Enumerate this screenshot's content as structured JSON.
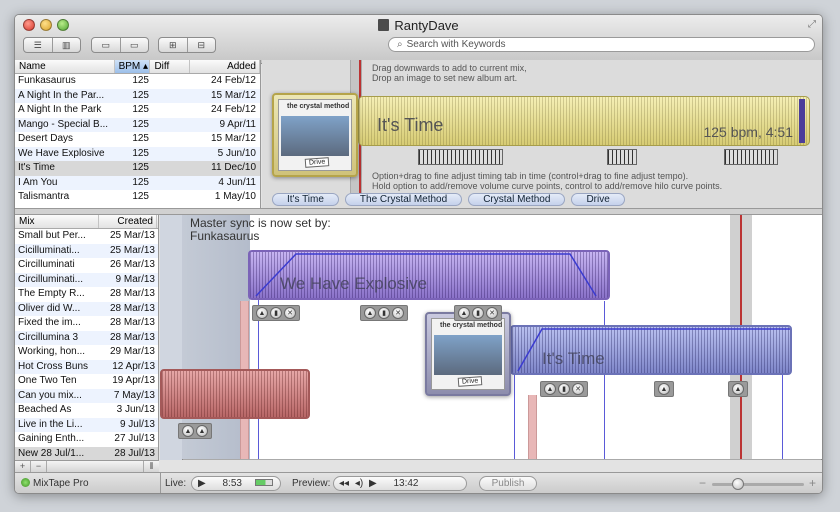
{
  "window": {
    "title": "RantyDave"
  },
  "search": {
    "placeholder": "Search with Keywords"
  },
  "songs": {
    "columns": [
      "Name",
      "BPM",
      "Diff",
      "Added"
    ],
    "rows": [
      {
        "name": "Funkasaurus",
        "bpm": "125",
        "diff": "",
        "added": "24 Feb/12"
      },
      {
        "name": "A Night In the Par...",
        "bpm": "125",
        "diff": "",
        "added": "15 Mar/12"
      },
      {
        "name": "A Night In the Park",
        "bpm": "125",
        "diff": "",
        "added": "24 Feb/12"
      },
      {
        "name": "Mango - Special B...",
        "bpm": "125",
        "diff": "",
        "added": "9 Apr/11"
      },
      {
        "name": "Desert Days",
        "bpm": "125",
        "diff": "",
        "added": "15 Mar/12"
      },
      {
        "name": "We Have Explosive",
        "bpm": "125",
        "diff": "",
        "added": "5 Jun/10"
      },
      {
        "name": "It's Time",
        "bpm": "125",
        "diff": "",
        "added": "11 Dec/10"
      },
      {
        "name": "I Am You",
        "bpm": "125",
        "diff": "",
        "added": "4 Jun/11"
      },
      {
        "name": "Talismantra",
        "bpm": "125",
        "diff": "",
        "added": "1 May/10"
      }
    ]
  },
  "editor": {
    "hint_top_1": "Drag downwards to add to current mix,",
    "hint_top_2": "Drop an image to set new album art.",
    "hint_bottom_1": "Option+drag to fine adjust timing tab in time (control+drag to fine adjust tempo).",
    "hint_bottom_2": "Hold option to add/remove volume curve points, control to add/remove hilo curve points.",
    "track_title": "It's Time",
    "track_bpm": "125 bpm, 4:51",
    "album_caption": "the crystal method",
    "album_stamp": "Drive",
    "tabs": [
      "It's Time",
      "The Crystal Method",
      "Crystal Method",
      "Drive"
    ]
  },
  "mixes": {
    "columns": [
      "Mix",
      "Created"
    ],
    "rows": [
      {
        "name": "Small but Per...",
        "created": "25 Mar/13"
      },
      {
        "name": "Cicilluminati...",
        "created": "25 Mar/13"
      },
      {
        "name": "Circilluminati",
        "created": "26 Mar/13"
      },
      {
        "name": "Circilluminati...",
        "created": "9 Mar/13"
      },
      {
        "name": "The Empty R...",
        "created": "28 Mar/13"
      },
      {
        "name": "Oliver did W...",
        "created": "28 Mar/13"
      },
      {
        "name": "Fixed the im...",
        "created": "28 Mar/13"
      },
      {
        "name": "Circillumina 3",
        "created": "28 Mar/13"
      },
      {
        "name": "Working, hon...",
        "created": "29 Mar/13"
      },
      {
        "name": "Hot Cross Buns",
        "created": "12 Apr/13"
      },
      {
        "name": "One Two Ten",
        "created": "19 Apr/13"
      },
      {
        "name": "Can you mix...",
        "created": "7 May/13"
      },
      {
        "name": "Beached As",
        "created": "3 Jun/13"
      },
      {
        "name": "Live in the Li...",
        "created": "9 Jul/13"
      },
      {
        "name": "Gaining Enth...",
        "created": "27 Jul/13"
      },
      {
        "name": "New 28 Jul/1...",
        "created": "28 Jul/13"
      }
    ]
  },
  "timeline": {
    "sync_line_1": "Master sync is now set by:",
    "sync_line_2": "Funkasaurus",
    "clip_1": "We Have Explosive",
    "clip_2": "It's Time",
    "album_caption": "the crystal method",
    "album_stamp": "Drive"
  },
  "statusbar": {
    "app": "MixTape Pro",
    "live_label": "Live:",
    "live_time": "8:53",
    "preview_label": "Preview:",
    "preview_time": "13:42",
    "publish": "Publish"
  },
  "colors": {
    "accent_blue": "#5a5ad8",
    "clip_purple": "#9b86d6",
    "clip_red": "#c77b7b",
    "clip_yellow": "#d7cc74"
  }
}
